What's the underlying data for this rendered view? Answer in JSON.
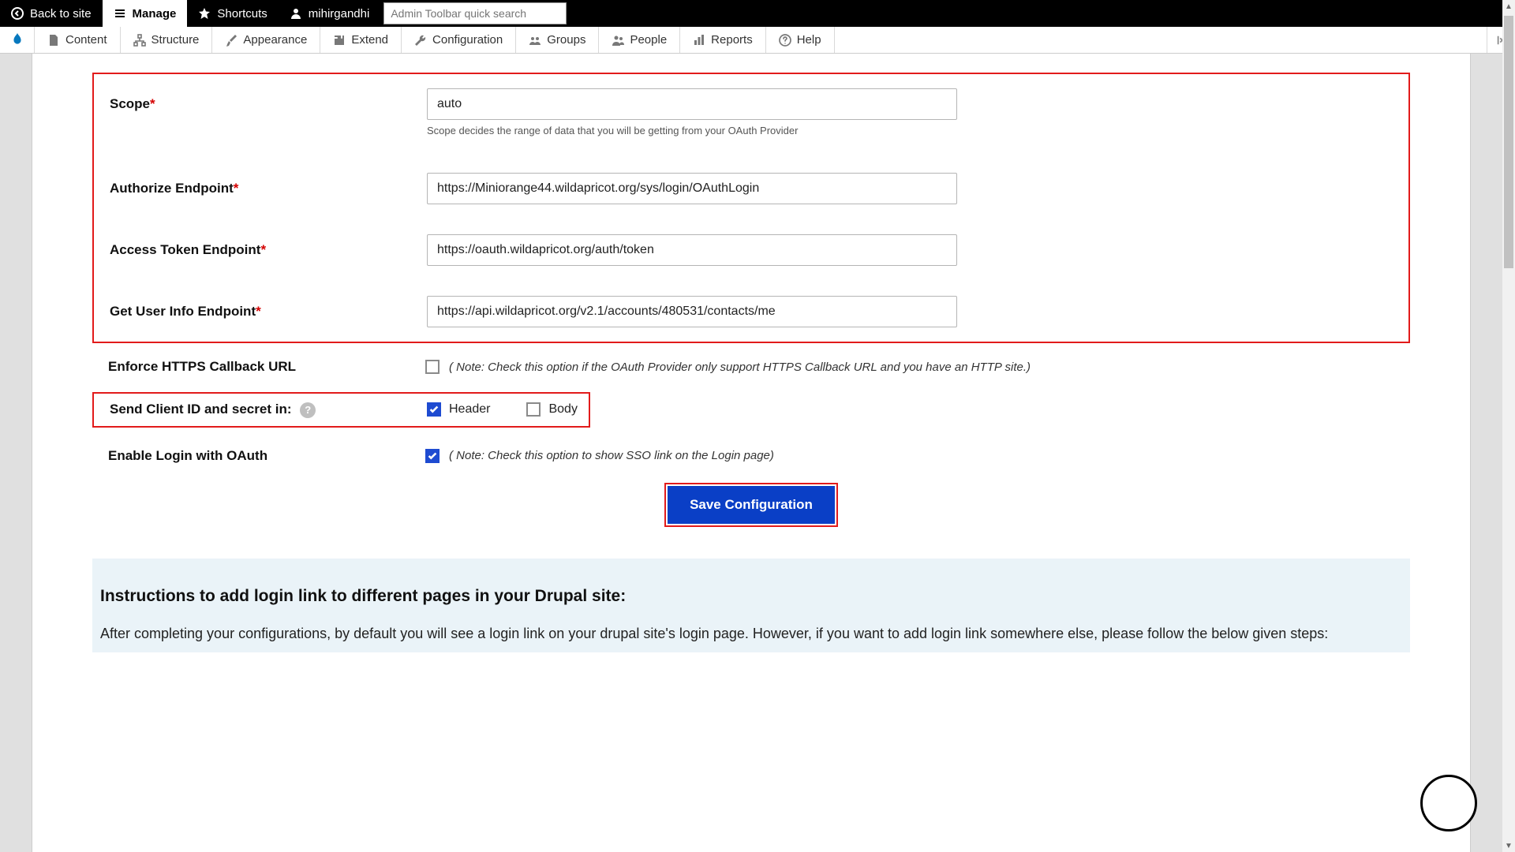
{
  "adminbar": {
    "back": "Back to site",
    "manage": "Manage",
    "shortcuts": "Shortcuts",
    "user": "mihirgandhi",
    "search_placeholder": "Admin Toolbar quick search"
  },
  "toolbar": {
    "items": [
      "Content",
      "Structure",
      "Appearance",
      "Extend",
      "Configuration",
      "Groups",
      "People",
      "Reports",
      "Help"
    ]
  },
  "form": {
    "scope_label": "Scope",
    "scope_value": "auto",
    "scope_help": "Scope decides the range of data that you will be getting from your OAuth Provider",
    "authorize_label": "Authorize Endpoint",
    "authorize_value": "https://Miniorange44.wildapricot.org/sys/login/OAuthLogin",
    "token_label": "Access Token Endpoint",
    "token_value": "https://oauth.wildapricot.org/auth/token",
    "userinfo_label": "Get User Info Endpoint",
    "userinfo_value": "https://api.wildapricot.org/v2.1/accounts/480531/contacts/me",
    "enforce_label": "Enforce HTTPS Callback URL",
    "enforce_note": "( Note: Check this option if the OAuth Provider only support HTTPS Callback URL and you have an HTTP site.)",
    "send_label": "Send Client ID and secret in:",
    "cb_header": "Header",
    "cb_body": "Body",
    "enable_label": "Enable Login with OAuth",
    "enable_note": "( Note: Check this option to show SSO link on the Login page)",
    "save": "Save Configuration"
  },
  "instructions": {
    "heading": "Instructions to add login link to different pages in your Drupal site:",
    "body": "After completing your configurations, by default you will see a login link on your drupal site's login page. However, if you want to add login link somewhere else, please follow the below given steps:"
  }
}
